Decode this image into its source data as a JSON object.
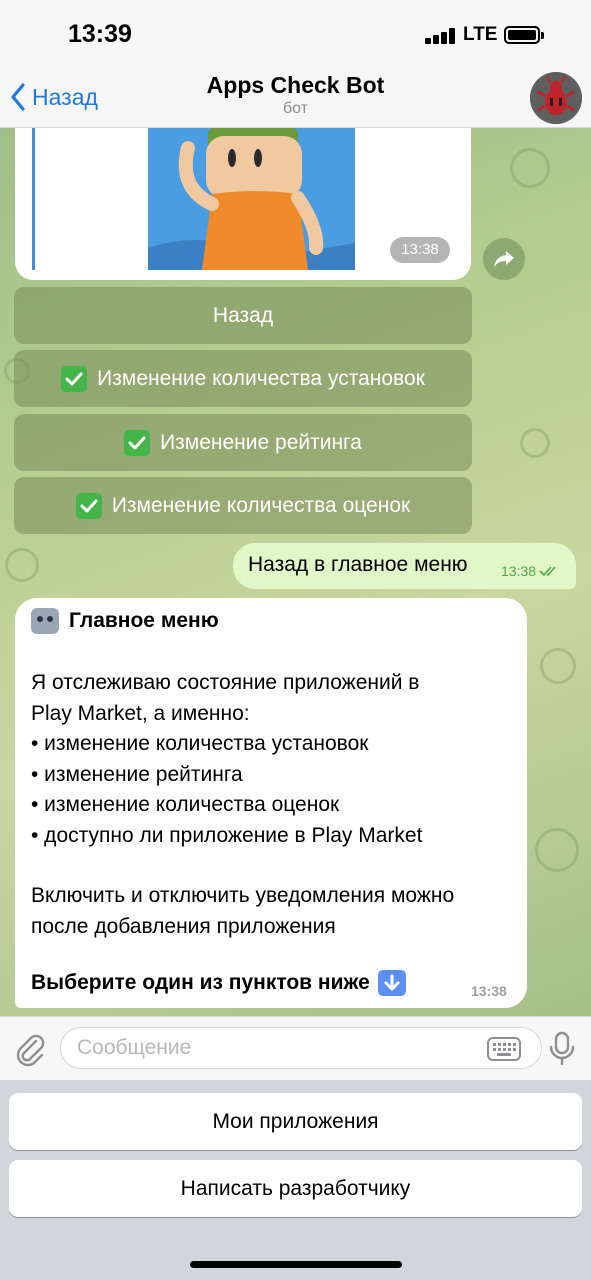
{
  "status_bar": {
    "time": "13:39",
    "network": "LTE"
  },
  "header": {
    "back_label": "Назад",
    "title": "Apps Check Bot",
    "subtitle": "бот"
  },
  "image_message": {
    "time": "13:38"
  },
  "inline_buttons": [
    {
      "label": "Назад",
      "checked": false
    },
    {
      "label": "Изменение количества установок",
      "checked": true
    },
    {
      "label": "Изменение рейтинга",
      "checked": true
    },
    {
      "label": "Изменение количества оценок",
      "checked": true
    }
  ],
  "outgoing_message": {
    "text": "Назад в главное меню",
    "time": "13:38"
  },
  "main_menu_message": {
    "title": "Главное меню",
    "line1": "Я отслеживаю состояние приложений в",
    "line2": "Play Market, а именно:",
    "bullet1": "• изменение количества установок",
    "bullet2": "• изменение рейтинга",
    "bullet3": "• изменение количества оценок",
    "bullet4": "• доступно ли приложение в Play Market",
    "line3": "Включить и отключить уведомления можно",
    "line4": "после добавления приложения",
    "footer": "Выберите один из пунктов ниже",
    "time": "13:38"
  },
  "input": {
    "placeholder": "Сообщение"
  },
  "reply_keyboard": {
    "btn1": "Мои приложения",
    "btn2": "Написать разработчику"
  },
  "colors": {
    "accent": "#1f7ae0",
    "check_green": "#44b548",
    "out_bubble": "#e1f7c8"
  }
}
